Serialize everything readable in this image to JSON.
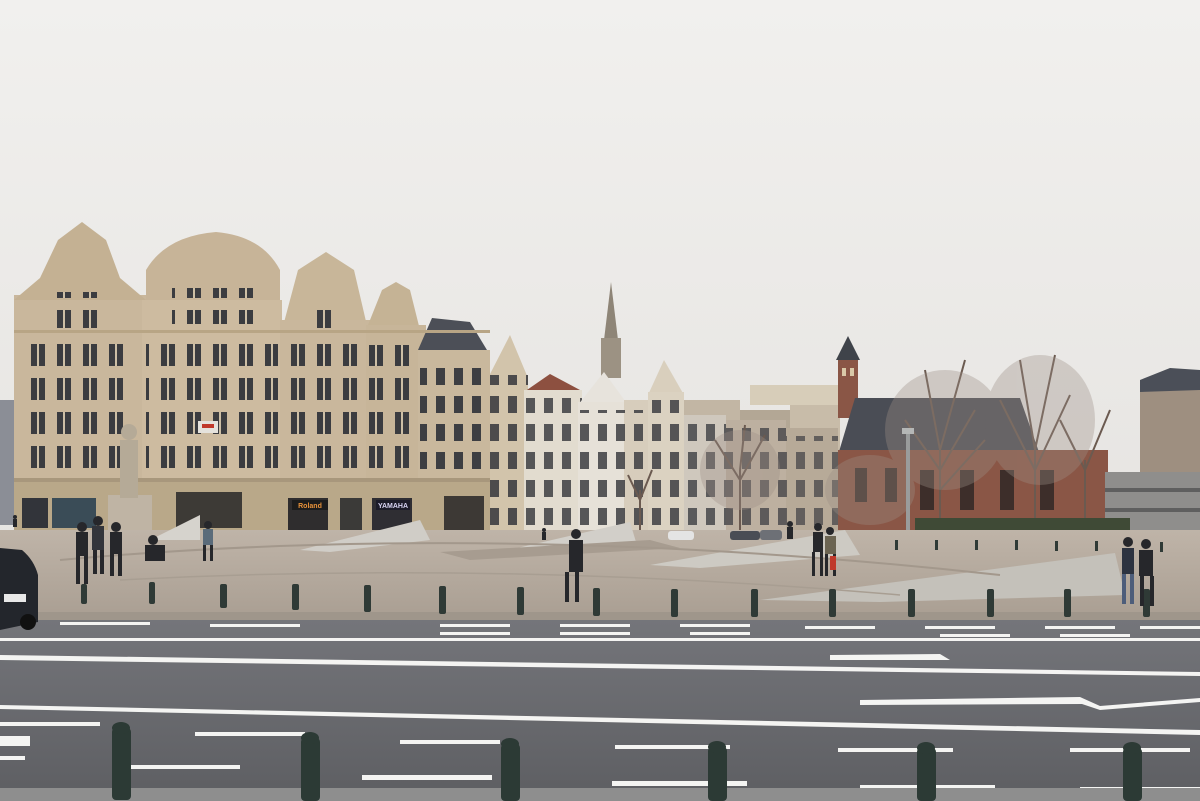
{
  "scene": {
    "description_free": true,
    "signs": {
      "shop_sign_1": "Roland",
      "shop_sign_2": "YAMAHA"
    },
    "colors": {
      "sky": "#ecebe9",
      "facade": "#c9b79c",
      "facade_shadow": "#a8977c",
      "roof": "#4a4d55",
      "brick": "#8a5646",
      "pavement": "#b8ada0",
      "road": "#6a6b6e",
      "bollard": "#2f3a36",
      "marking": "#f4f4f2",
      "tree": "#6b5a50"
    }
  }
}
